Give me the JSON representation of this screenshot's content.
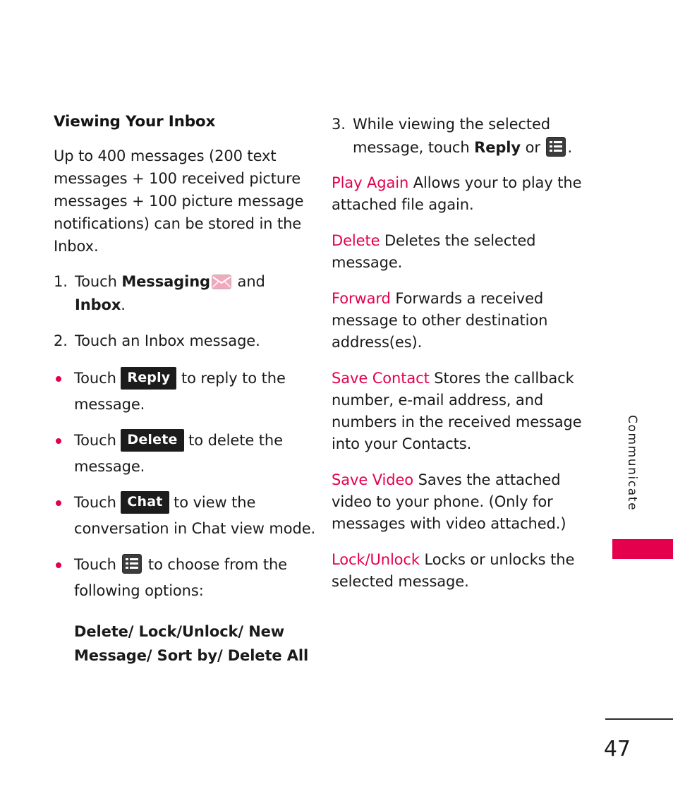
{
  "page": {
    "number": "47",
    "side_tab": "Communicate"
  },
  "left_column": {
    "title": "Viewing Your Inbox",
    "intro": "Up to 400 messages (200 text messages + 100 received picture messages + 100 picture message notifications) can be stored in the Inbox.",
    "steps": [
      {
        "num": "1.",
        "text_before": "Touch ",
        "bold1": "Messaging",
        "icon": "envelope-icon",
        "text_mid": " and ",
        "bold2": "Inbox",
        "text_after": "."
      },
      {
        "num": "2.",
        "text_before": "Touch an Inbox message.",
        "bold1": "",
        "icon": "",
        "text_mid": "",
        "bold2": "",
        "text_after": ""
      }
    ],
    "bullets": [
      {
        "before": "Touch ",
        "key": "Reply",
        "after": " to reply to the message."
      },
      {
        "before": "Touch ",
        "key": "Delete",
        "after": " to delete the message."
      },
      {
        "before": "Touch ",
        "key": "Chat",
        "after": " to view the conversation in Chat view mode."
      },
      {
        "before": "Touch ",
        "key": "",
        "icon": "list-menu-icon",
        "after": " to choose from the following options:"
      }
    ],
    "options_line": "Delete/ Lock/Unlock/ New Message/ Sort by/ Delete All"
  },
  "right_column": {
    "step": {
      "num": "3.",
      "before": "While viewing the selected message, touch ",
      "bold": "Reply",
      "mid": " or ",
      "icon": "list-menu-icon",
      "after": "."
    },
    "definitions": [
      {
        "term": "Play Again",
        "desc": "  Allows your to play the attached file again."
      },
      {
        "term": "Delete",
        "desc": "  Deletes the selected message."
      },
      {
        "term": "Forward",
        "desc": " Forwards a received message to other destination address(es)."
      },
      {
        "term": "Save Contact",
        "desc": " Stores the callback number, e-mail address, and numbers in the received message into your Contacts."
      },
      {
        "term": "Save Video",
        "desc": "  Saves the attached video to your phone. (Only for messages with video attached.)"
      },
      {
        "term": "Lock/Unlock",
        "desc": " Locks or unlocks the selected message."
      }
    ]
  },
  "colors": {
    "accent": "#e4004c",
    "text": "#1a1a1a",
    "keycap_bg": "#1c1c1c"
  }
}
